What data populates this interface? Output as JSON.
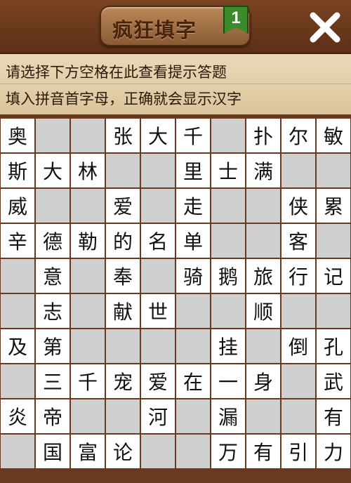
{
  "header": {
    "title": "疯狂填字",
    "level": "1"
  },
  "hint": {
    "line1": "请选择下方空格在此查看提示答题",
    "line2": "填入拼音首字母，正确就会显示汉字"
  },
  "colors": {
    "wood": "#6b3a1e",
    "white_cell": "#ffffff",
    "blocked_cell": "#cfcfcf",
    "badge": "#3c8a2c"
  },
  "grid": [
    [
      "奥",
      null,
      null,
      "张",
      "大",
      "千",
      null,
      "扑",
      "尔",
      "敏"
    ],
    [
      "斯",
      "大",
      "林",
      null,
      null,
      "里",
      "士",
      "满",
      null,
      null
    ],
    [
      "威",
      null,
      null,
      "爱",
      null,
      "走",
      null,
      null,
      "侠",
      "累"
    ],
    [
      "辛",
      "德",
      "勒",
      "的",
      "名",
      "单",
      null,
      null,
      "客",
      null
    ],
    [
      null,
      "意",
      null,
      "奉",
      null,
      "骑",
      "鹅",
      "旅",
      "行",
      "记"
    ],
    [
      null,
      "志",
      null,
      "献",
      "世",
      null,
      null,
      "顺",
      null,
      null
    ],
    [
      "及",
      "第",
      null,
      null,
      null,
      null,
      "挂",
      null,
      "倒",
      "孔"
    ],
    [
      null,
      "三",
      "千",
      "宠",
      "爱",
      "在",
      "一",
      "身",
      null,
      "武"
    ],
    [
      "炎",
      "帝",
      null,
      null,
      "河",
      null,
      "漏",
      null,
      null,
      "有"
    ],
    [
      null,
      "国",
      "富",
      "论",
      null,
      null,
      "万",
      "有",
      "引",
      "力"
    ]
  ]
}
